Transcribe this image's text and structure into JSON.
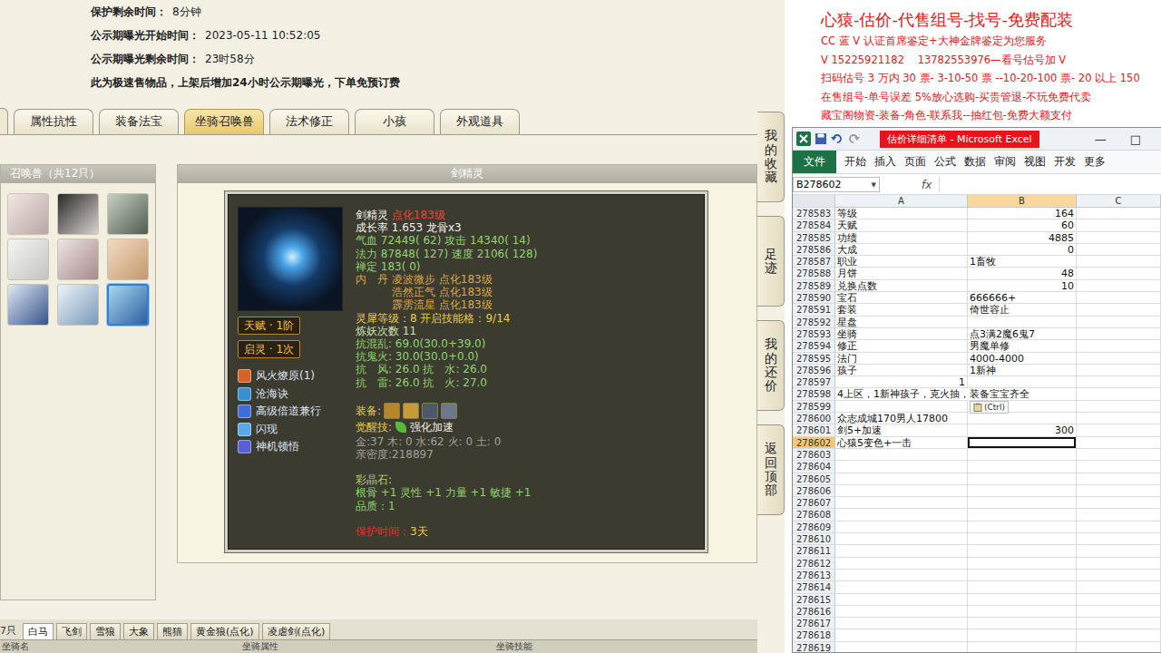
{
  "sale_info": [
    {
      "label": "保护剩余时间：",
      "value": "8分钟"
    },
    {
      "label": "公示期曝光开始时间：",
      "value": "2023-05-11 10:52:05"
    },
    {
      "label": "公示期曝光剩余时间：",
      "value": "23时58分"
    }
  ],
  "sale_note": "此为极速售物品，上架后增加24小时公示期曝光，下单免预订费",
  "tabs": [
    {
      "label": "属性抗性",
      "selected": false
    },
    {
      "label": "装备法宝",
      "selected": false
    },
    {
      "label": "坐骑召唤兽",
      "selected": true
    },
    {
      "label": "法术修正",
      "selected": false
    },
    {
      "label": "小孩",
      "selected": false
    },
    {
      "label": "外观道具",
      "selected": false
    }
  ],
  "pet_list": {
    "title": "召唤兽（共12只）",
    "pets": [
      {
        "selected": false
      },
      {
        "selected": false
      },
      {
        "selected": false
      },
      {
        "selected": false
      },
      {
        "selected": false
      },
      {
        "selected": false
      },
      {
        "selected": false
      },
      {
        "selected": false
      },
      {
        "selected": true
      }
    ]
  },
  "pet_detail": {
    "title": "剑精灵",
    "badges": [
      "天赋 · 1阶",
      "启灵 · 1次"
    ],
    "skills": [
      {
        "name": "风火燎原(1)",
        "color": "#d9622b"
      },
      {
        "name": "沧海诀",
        "color": "#3a8fd0"
      },
      {
        "name": "高级倍道兼行",
        "color": "#3f6fd6"
      },
      {
        "name": "闪现",
        "color": "#5aa8e8"
      },
      {
        "name": "神机顿悟",
        "color": "#5a5fd8"
      }
    ],
    "groups": [
      [
        {
          "kind": "text",
          "segments": [
            {
              "text": "剑精灵 ",
              "color": "#f2f2ea"
            },
            {
              "text": "点化183级",
              "color": "#e5483a"
            }
          ]
        },
        {
          "kind": "text",
          "segments": [
            {
              "text": "成长率 1.653 龙骨x3",
              "color": "#f2f2ea"
            }
          ]
        },
        {
          "kind": "text",
          "segments": [
            {
              "text": "气血 72449( 62) 攻击 14340( 14)",
              "color": "#8fd46f"
            }
          ]
        },
        {
          "kind": "text",
          "segments": [
            {
              "text": "法力 87848( 127) 速度 2106( 128)",
              "color": "#8fd46f"
            }
          ]
        },
        {
          "kind": "text",
          "segments": [
            {
              "text": "禅定 183( 0)",
              "color": "#8fd46f"
            }
          ]
        },
        {
          "kind": "pair",
          "label": "内　丹",
          "text": "凌波微步 点化183级",
          "color": "#d9a74a"
        },
        {
          "kind": "pair",
          "label": "",
          "text": "浩然正气 点化183级",
          "color": "#d9a74a"
        },
        {
          "kind": "pair",
          "label": "",
          "text": "霹雳流星 点化183级",
          "color": "#d9a74a"
        },
        {
          "kind": "text",
          "segments": [
            {
              "text": "灵犀等级：8 开启技能格：9/14",
              "color": "#e8cc4a"
            }
          ]
        },
        {
          "kind": "text",
          "segments": [
            {
              "text": "炼妖次数 11",
              "color": "#cfe0b0"
            }
          ]
        },
        {
          "kind": "text",
          "segments": [
            {
              "text": "抗混乱: 69.0(30.0+39.0)",
              "color": "#8fd46f"
            }
          ]
        },
        {
          "kind": "text",
          "segments": [
            {
              "text": "抗鬼火: 30.0(30.0+0.0)",
              "color": "#8fd46f"
            }
          ]
        },
        {
          "kind": "text",
          "segments": [
            {
              "text": "抗　风: 26.0 抗　水: 26.0",
              "color": "#8fd46f"
            }
          ]
        },
        {
          "kind": "text",
          "segments": [
            {
              "text": "抗　雷: 26.0 抗　火: 27.0",
              "color": "#8fd46f"
            }
          ]
        }
      ],
      [
        {
          "kind": "equip",
          "label": "装备:",
          "color": "#e8cc4a",
          "items": [
            {
              "color": "#b8862a"
            },
            {
              "color": "#c89a3a"
            },
            {
              "color": "#4a5a6a"
            },
            {
              "color": "#6a7a8a"
            }
          ]
        },
        {
          "kind": "skill",
          "label": "觉醒技:",
          "color": "#e8cc4a",
          "icon_color": "#5cb83a",
          "text": "强化加速",
          "text_color": "#f2f2ea"
        },
        {
          "kind": "text",
          "segments": [
            {
              "text": "金:37 木: 0 水:62 火: 0 土: 0",
              "color": "#a0a09a"
            }
          ]
        },
        {
          "kind": "text",
          "segments": [
            {
              "text": "亲密度:218897",
              "color": "#a0a09a"
            }
          ]
        }
      ],
      [
        {
          "kind": "text",
          "segments": [
            {
              "text": "彩晶石:",
              "color": "#b8d070"
            }
          ]
        },
        {
          "kind": "text",
          "segments": [
            {
              "text": "根骨 +1 灵性 +1 力量 +1 敏捷 +1",
              "color": "#8fd46f"
            }
          ]
        },
        {
          "kind": "text",
          "segments": [
            {
              "text": "品质：1",
              "color": "#8fd46f"
            }
          ]
        }
      ],
      [
        {
          "kind": "text",
          "segments": [
            {
              "text": "保护时间：",
              "color": "#e5302a"
            },
            {
              "text": "3天",
              "color": "#e8cc4a"
            }
          ]
        }
      ]
    ]
  },
  "side_tabs": [
    "我的收藏",
    "足迹",
    "我的还价",
    "返回顶部"
  ],
  "mount_strip": {
    "count": "7只",
    "tabs": [
      {
        "label": "白马",
        "selected": true
      },
      {
        "label": "飞剑",
        "selected": false
      },
      {
        "label": "雪狼",
        "selected": false
      },
      {
        "label": "大象",
        "selected": false
      },
      {
        "label": "熊猫",
        "selected": false
      },
      {
        "label": "黄金狼(点化)",
        "selected": false
      },
      {
        "label": "凌虐剑(点化)",
        "selected": false
      }
    ],
    "columns": [
      "坐骑名",
      "坐骑属性",
      "坐骑技能"
    ]
  },
  "ad": {
    "title": "心猿-估价-代售组号-找号-免费配装",
    "lines": [
      "CC 蓝 V 认证首席鉴定+大神金牌鉴定为您服务",
      "V 15225921182    13782553976—看号估号加 V",
      "扫码估号 3 万内 30 票- 3-10-50 票 --10-20-100 票- 20 以上 150",
      "在售组号-单号误差 5%放心选购-买贵管退-不玩免费代卖",
      "藏宝阁物资-装备-角色-联系我--抽红包-免费大额支付"
    ]
  },
  "excel": {
    "title": "估价详细清单 - Microsoft Excel",
    "controls": [
      "—",
      "□"
    ],
    "ribbon": [
      {
        "label": "文件",
        "kind": "file"
      },
      {
        "label": "开始",
        "kind": "tab"
      },
      {
        "label": "插入",
        "kind": "tab"
      },
      {
        "label": "页面",
        "kind": "tab"
      },
      {
        "label": "公式",
        "kind": "tab"
      },
      {
        "label": "数据",
        "kind": "tab"
      },
      {
        "label": "审阅",
        "kind": "tab"
      },
      {
        "label": "视图",
        "kind": "tab"
      },
      {
        "label": "开发",
        "kind": "tab"
      },
      {
        "label": "更多",
        "kind": "tab"
      }
    ],
    "name_box": "B278602",
    "name_box_arrow": "▼",
    "fx": "fx",
    "columns": [
      {
        "label": "A",
        "selected": false
      },
      {
        "label": "B",
        "selected": true
      },
      {
        "label": "C",
        "selected": false
      }
    ],
    "rows": [
      {
        "n": "278583",
        "a": "等级",
        "b": "164",
        "selected": false
      },
      {
        "n": "278584",
        "a": "天赋",
        "b": "60",
        "selected": false
      },
      {
        "n": "278585",
        "a": "功绩",
        "b": "4885",
        "selected": false
      },
      {
        "n": "278586",
        "a": "大成",
        "b": "0",
        "selected": false
      },
      {
        "n": "278587",
        "a": "职业",
        "b": "1畜牧",
        "selected": false
      },
      {
        "n": "278588",
        "a": "月饼",
        "b": "48",
        "selected": false
      },
      {
        "n": "278589",
        "a": "兑换点数",
        "b": "10",
        "selected": false
      },
      {
        "n": "278590",
        "a": "宝石",
        "b": "666666+",
        "selected": false
      },
      {
        "n": "278591",
        "a": "套装",
        "b": "倚世容止",
        "selected": false
      },
      {
        "n": "278592",
        "a": "星盘",
        "b": "",
        "selected": false
      },
      {
        "n": "278593",
        "a": "坐骑",
        "b": "点3满2魔6鬼7",
        "selected": false
      },
      {
        "n": "278594",
        "a": "修正",
        "b": "男魔单修",
        "selected": false
      },
      {
        "n": "278595",
        "a": "法门",
        "b": "4000-4000",
        "selected": false
      },
      {
        "n": "278596",
        "a": "孩子",
        "b": "1新神",
        "selected": false
      },
      {
        "n": "278597",
        "a": "1",
        "b": "",
        "selected": false
      },
      {
        "n": "278598",
        "a": "4上区，1新神孩子，克火抽，装备宝宝齐全",
        "b": "",
        "selected": false
      },
      {
        "n": "278599",
        "a": "",
        "b": "",
        "selected": false,
        "popup": "(Ctrl)"
      },
      {
        "n": "278600",
        "a": "众志成城170男人17800",
        "b": "",
        "selected": false
      },
      {
        "n": "278601",
        "a": "剑5+加速",
        "b": "300",
        "selected": false
      },
      {
        "n": "278602",
        "a": "心猿5变色+一击",
        "b": "",
        "selected": true
      },
      {
        "n": "278603",
        "a": "",
        "b": "",
        "selected": false
      },
      {
        "n": "278604",
        "a": "",
        "b": "",
        "selected": false
      },
      {
        "n": "278605",
        "a": "",
        "b": "",
        "selected": false
      },
      {
        "n": "278606",
        "a": "",
        "b": "",
        "selected": false
      },
      {
        "n": "278607",
        "a": "",
        "b": "",
        "selected": false
      },
      {
        "n": "278608",
        "a": "",
        "b": "",
        "selected": false
      },
      {
        "n": "278609",
        "a": "",
        "b": "",
        "selected": false
      },
      {
        "n": "278610",
        "a": "",
        "b": "",
        "selected": false
      },
      {
        "n": "278611",
        "a": "",
        "b": "",
        "selected": false
      },
      {
        "n": "278612",
        "a": "",
        "b": "",
        "selected": false
      },
      {
        "n": "278613",
        "a": "",
        "b": "",
        "selected": false
      },
      {
        "n": "278614",
        "a": "",
        "b": "",
        "selected": false
      },
      {
        "n": "278615",
        "a": "",
        "b": "",
        "selected": false
      },
      {
        "n": "278616",
        "a": "",
        "b": "",
        "selected": false
      },
      {
        "n": "278617",
        "a": "",
        "b": "",
        "selected": false
      },
      {
        "n": "278618",
        "a": "",
        "b": "",
        "selected": false
      },
      {
        "n": "278619",
        "a": "",
        "b": "",
        "selected": false
      }
    ]
  }
}
